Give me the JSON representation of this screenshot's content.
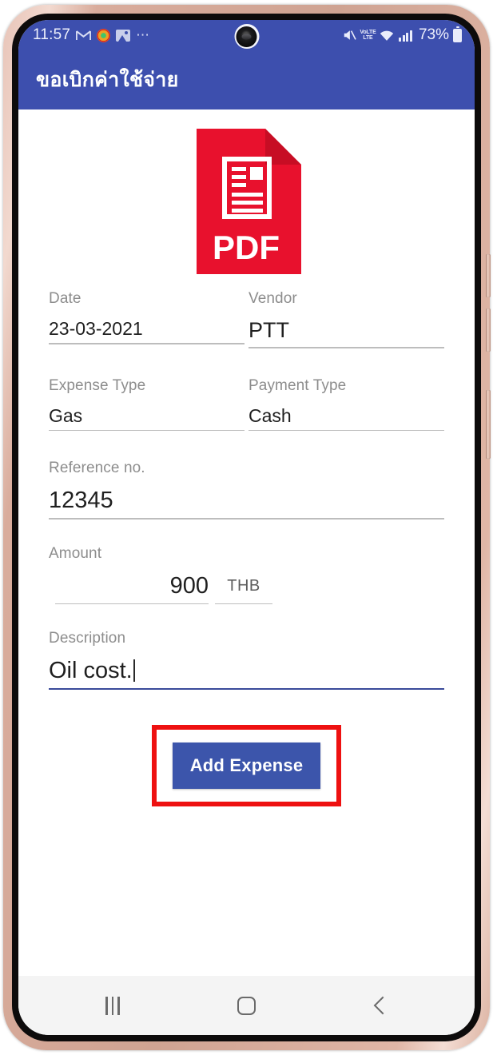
{
  "device": {
    "frame_color": "#cfa392",
    "bezel_color": "#0d0b0b"
  },
  "status_bar": {
    "clock": "11:57",
    "battery_percent": "73%",
    "more_dots": "⋯",
    "volte_top": "VoLTE",
    "volte_bottom": "LTE",
    "left_icons": [
      "gmail-icon",
      "circle-app-icon",
      "gallery-icon",
      "overflow-dots-icon"
    ],
    "right_icons": [
      "mute-icon",
      "volte-icon",
      "wifi-icon",
      "signal-icon",
      "battery-icon"
    ],
    "background": "#3d4fae"
  },
  "app_bar": {
    "title": "ขอเบิกค่าใช้จ่าย",
    "background": "#3d4fae"
  },
  "attachment": {
    "type": "pdf",
    "label": "PDF",
    "color": "#e8112d"
  },
  "form": {
    "date": {
      "label": "Date",
      "value": "23-03-2021"
    },
    "vendor": {
      "label": "Vendor",
      "value": "PTT"
    },
    "expense_type": {
      "label": "Expense Type",
      "value": "Gas"
    },
    "payment_type": {
      "label": "Payment Type",
      "value": "Cash"
    },
    "reference_no": {
      "label": "Reference no.",
      "value": "12345"
    },
    "amount": {
      "label": "Amount",
      "value": "900",
      "currency": "THB"
    },
    "description": {
      "label": "Description",
      "value": "Oil cost.",
      "focused": true
    }
  },
  "actions": {
    "submit_label": "Add Expense",
    "submit_color": "#3c55ab",
    "highlight_color": "#ee1111"
  },
  "nav_bar": {
    "recents_label": "Recents",
    "home_label": "Home",
    "back_label": "Back"
  }
}
